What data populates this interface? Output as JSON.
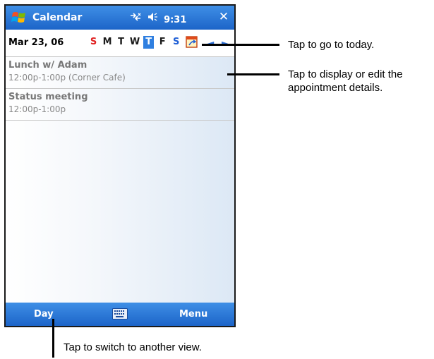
{
  "titlebar": {
    "app_title": "Calendar",
    "time": "9:31",
    "close_label": "✕"
  },
  "toolbar": {
    "date": "Mar 23, 06",
    "weekdays": [
      {
        "label": "S",
        "type": "sun"
      },
      {
        "label": "M",
        "type": ""
      },
      {
        "label": "T",
        "type": ""
      },
      {
        "label": "W",
        "type": ""
      },
      {
        "label": "T",
        "type": "sel"
      },
      {
        "label": "F",
        "type": ""
      },
      {
        "label": "S",
        "type": "sat"
      }
    ],
    "prev_label": "◄",
    "next_label": "►"
  },
  "appointments": [
    {
      "title": "Lunch w/ Adam",
      "time": "12:00p-1:00p (Corner Cafe)"
    },
    {
      "title": "Status meeting",
      "time": "12:00p-1:00p"
    }
  ],
  "menubar": {
    "left": "Day",
    "right": "Menu"
  },
  "callouts": {
    "today": "Tap to go to today.",
    "details_line1": "Tap to display or edit the",
    "details_line2": "appointment details.",
    "view": "Tap to switch to another view."
  },
  "colors": {
    "bar": "#2a74dc",
    "sunday": "#e02020",
    "saturday": "#1f5fd6",
    "selected": "#2f7fe0"
  },
  "icons": [
    "windows-logo-icon",
    "connectivity-icon",
    "volume-icon",
    "close-icon",
    "today-icon",
    "keyboard-icon"
  ]
}
